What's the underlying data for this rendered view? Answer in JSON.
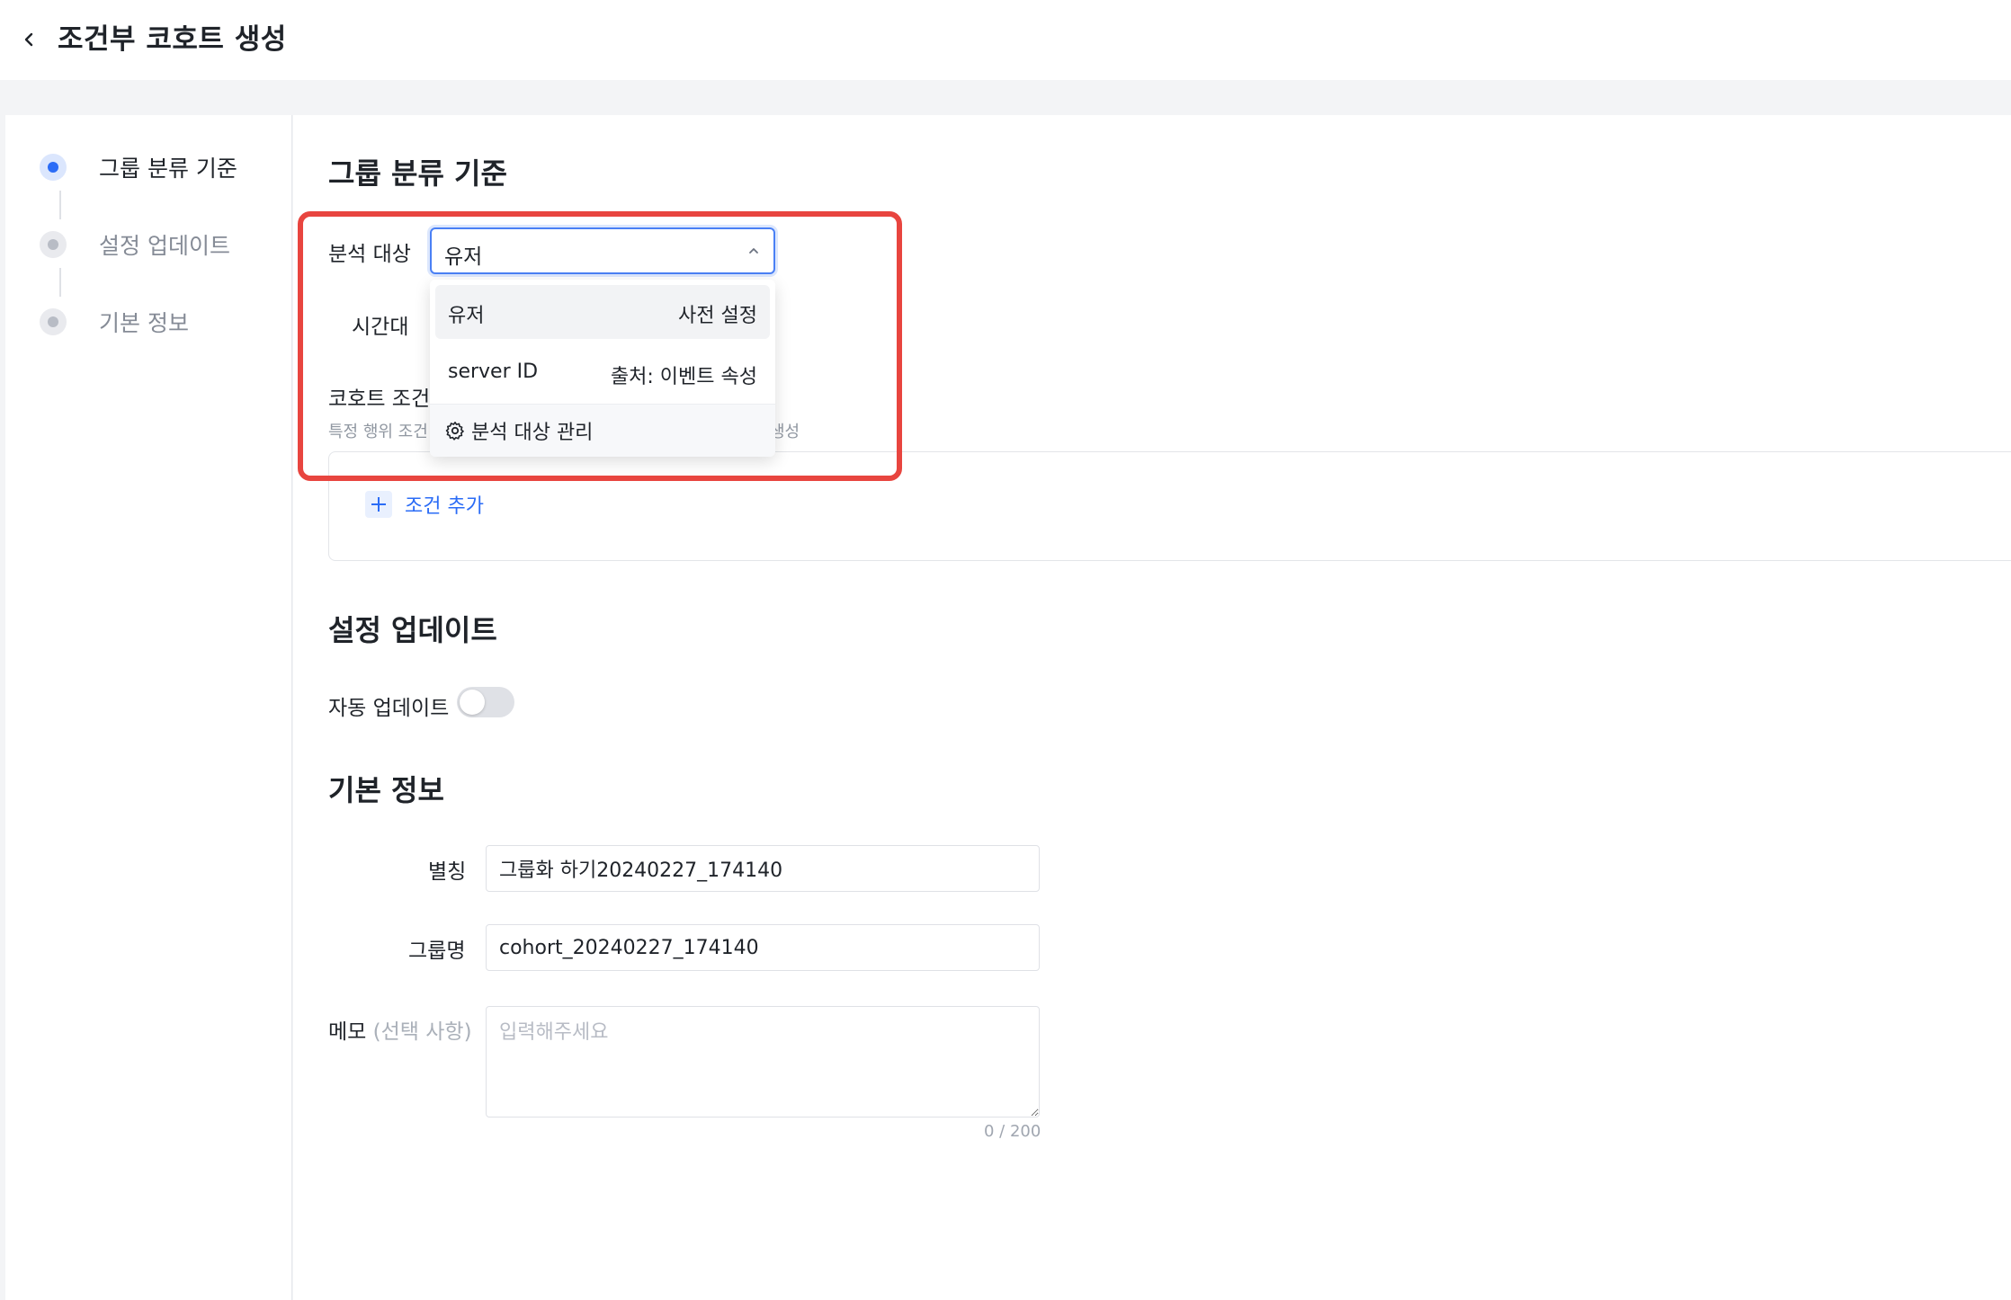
{
  "header": {
    "title": "조건부 코호트 생성"
  },
  "steps": [
    {
      "label": "그룹 분류 기준",
      "active": true
    },
    {
      "label": "설정 업데이트",
      "active": false
    },
    {
      "label": "기본 정보",
      "active": false
    }
  ],
  "group_criteria": {
    "title": "그룹 분류 기준",
    "analysis_target_label": "분석 대상",
    "analysis_target_value": "유저",
    "time_label": "시간대",
    "cohort_condition_label": "코호트 조건",
    "cohort_condition_desc": "특정 행위 조건",
    "cohort_condition_desc_tail": "생성",
    "add_condition": "조건 추가"
  },
  "dropdown": {
    "items": [
      {
        "name": "유저",
        "source": "사전 설정"
      },
      {
        "name": "server ID",
        "source": "출처: 이벤트 속성"
      }
    ],
    "footer": "분석 대상 관리"
  },
  "settings_update": {
    "title": "설정 업데이트",
    "auto_update_label": "자동 업데이트",
    "auto_update_on": false
  },
  "basic_info": {
    "title": "기본 정보",
    "alias_label": "별칭",
    "alias_value": "그룹화 하기20240227_174140",
    "group_name_label": "그룹명",
    "group_name_value": "cohort_20240227_174140",
    "memo_label": "메모",
    "memo_optional": "(선택 사항)",
    "memo_placeholder": "입력해주세요",
    "memo_counter": "0 / 200"
  },
  "colors": {
    "accent": "#2b6cf6",
    "highlight": "#e8453f"
  }
}
